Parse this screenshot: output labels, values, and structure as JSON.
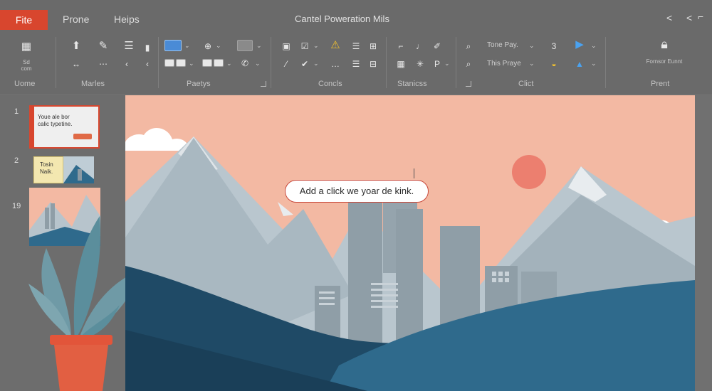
{
  "menu": {
    "file": "Fite",
    "tabs": [
      "Prone",
      "Heips"
    ]
  },
  "window": {
    "title": "Cantel Poweration Mils",
    "controls": [
      "<",
      "<"
    ]
  },
  "ribbon": {
    "groups": [
      "Uome",
      "Marles",
      "Paetys",
      "Concls",
      "Stanicss",
      "Clict",
      "Prent"
    ],
    "font_box_1": "Tone Pay.",
    "font_box_2": "This Praye",
    "small_label_left": "Sd\ncom",
    "small_label_right": "Fornsor\nEunnt"
  },
  "slides": {
    "numbers": [
      "1",
      "2",
      "19"
    ],
    "thumb1_text": "Youe ale bor\ncalic typetine.",
    "thumb2_text": "Tosin\nNaik."
  },
  "slide": {
    "callout": "Add a click we yoar de kink."
  },
  "colors": {
    "accent": "#d8462e",
    "sky": "#f3b9a3",
    "water": "#2f6a8c",
    "deep": "#1f4a66"
  }
}
